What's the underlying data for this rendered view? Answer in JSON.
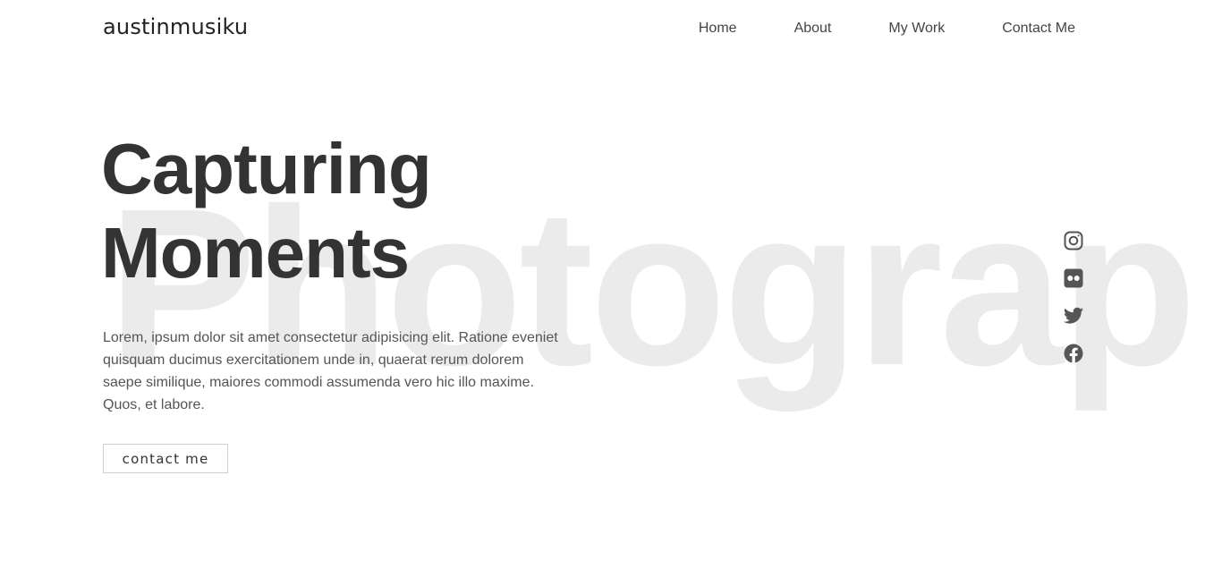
{
  "header": {
    "logo": "austinmusiku",
    "nav": [
      {
        "label": "Home"
      },
      {
        "label": "About"
      },
      {
        "label": "My Work"
      },
      {
        "label": "Contact Me"
      }
    ]
  },
  "hero": {
    "background_word": "Photography",
    "title_line1": "Capturing",
    "title_line2": "Moments",
    "description": "Lorem, ipsum dolor sit amet consectetur adipisicing elit. Ratione eveniet quisquam ducimus exercitationem unde in, quaerat rerum dolorem saepe similique, maiores commodi assumenda vero hic illo maxime. Quos, et labore.",
    "cta_label": "contact me"
  },
  "social": [
    {
      "icon": "instagram-icon"
    },
    {
      "icon": "flickr-icon"
    },
    {
      "icon": "twitter-icon"
    },
    {
      "icon": "facebook-icon"
    }
  ],
  "colors": {
    "text_dark": "#333333",
    "watermark": "#ebebeb",
    "icon": "#555555",
    "background": "#ffffff"
  }
}
